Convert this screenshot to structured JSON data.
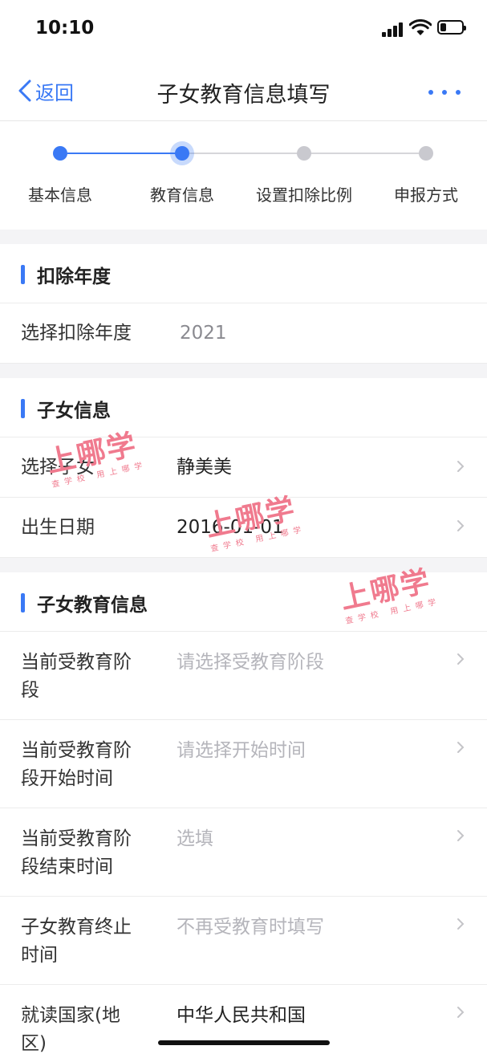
{
  "status_bar": {
    "time": "10:10"
  },
  "nav": {
    "back_label": "返回",
    "title": "子女教育信息填写"
  },
  "steps": [
    {
      "label": "基本信息",
      "state": "done"
    },
    {
      "label": "教育信息",
      "state": "current"
    },
    {
      "label": "设置扣除比例",
      "state": "todo"
    },
    {
      "label": "申报方式",
      "state": "todo"
    }
  ],
  "sections": {
    "deduction_year": {
      "title": "扣除年度",
      "rows": [
        {
          "label": "选择扣除年度",
          "value": "2021"
        }
      ]
    },
    "child_info": {
      "title": "子女信息",
      "rows": [
        {
          "label": "选择子女",
          "value": "静美美"
        },
        {
          "label": "出生日期",
          "value": "2016-01-01"
        }
      ]
    },
    "child_education": {
      "title": "子女教育信息",
      "rows": [
        {
          "label_line1": "当前受教育阶",
          "label_line2": "段",
          "placeholder": "请选择受教育阶段"
        },
        {
          "label_line1": "当前受教育阶",
          "label_line2": "段开始时间",
          "placeholder": "请选择开始时间"
        },
        {
          "label_line1": "当前受教育阶",
          "label_line2": "段结束时间",
          "placeholder": "选填"
        },
        {
          "label_line1": "子女教育终止",
          "label_line2": "时间",
          "placeholder": "不再受教育时填写"
        },
        {
          "label_line1": "就读国家(地",
          "label_line2": "区)",
          "value": "中华人民共和国"
        }
      ]
    }
  },
  "watermark": {
    "brand": "上哪学",
    "tagline": "查学校 用上哪学"
  },
  "colors": {
    "accent": "#3a79f5",
    "inactive_step": "#c9c9cf",
    "placeholder": "#b5b5bb",
    "section_gap": "#f4f4f6",
    "watermark": "#f07a8e"
  }
}
